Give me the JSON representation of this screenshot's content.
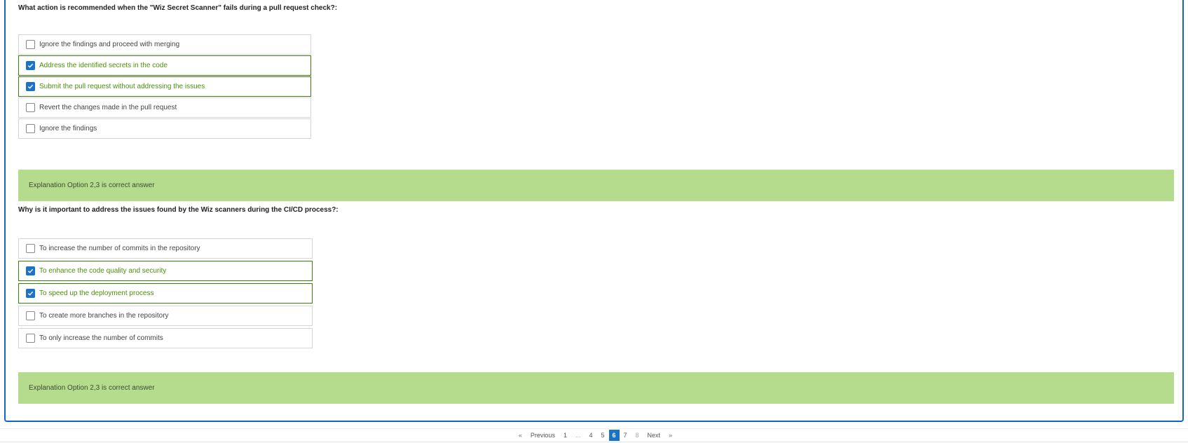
{
  "questions": [
    {
      "text": "What action is recommended when the \"Wiz Secret Scanner\" fails during a pull request check?:",
      "options": [
        {
          "label": "Ignore the findings and proceed with merging",
          "checked": false
        },
        {
          "label": "Address the identified secrets in the code",
          "checked": true
        },
        {
          "label": "Submit the pull request without addressing the issues",
          "checked": true
        },
        {
          "label": "Revert the changes made in the pull request",
          "checked": false
        },
        {
          "label": "Ignore the findings",
          "checked": false
        }
      ],
      "explanation": "Explanation Option 2,3 is correct answer"
    },
    {
      "text": "Why is it important to address the issues found by the Wiz scanners during the CI/CD process?:",
      "options": [
        {
          "label": "To increase the number of commits in the repository",
          "checked": false
        },
        {
          "label": "To enhance the code quality and security",
          "checked": true
        },
        {
          "label": "To speed up the deployment process",
          "checked": true
        },
        {
          "label": "To create more branches in the repository",
          "checked": false
        },
        {
          "label": "To only increase the number of commits",
          "checked": false
        }
      ],
      "explanation": "Explanation Option 2,3 is correct answer"
    }
  ],
  "pagination": {
    "prev_arrow": "«",
    "prev_label": "Previous",
    "pages": [
      "1",
      "...",
      "4",
      "5",
      "6",
      "7",
      "8"
    ],
    "current": "6",
    "next_label": "Next",
    "next_arrow": "»"
  },
  "colors": {
    "accent": "#1565c0",
    "checkbox_checked": "#1a73c8",
    "correct_text": "#4c8f0c",
    "correct_border": "#3a7d0a",
    "explanation_bg": "#b5dc8d"
  },
  "icons": {
    "checkbox_checked": "check-icon"
  }
}
